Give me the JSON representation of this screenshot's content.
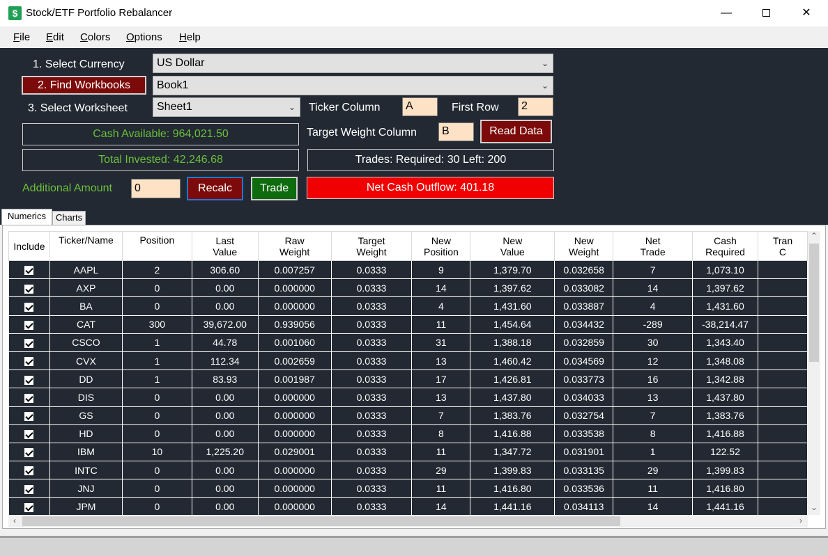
{
  "window": {
    "title": "Stock/ETF Portfolio Rebalancer",
    "minimize": "—",
    "close": "✕"
  },
  "menu": {
    "file": {
      "u": "F",
      "rest": "ile"
    },
    "edit": {
      "u": "E",
      "rest": "dit"
    },
    "colors": {
      "u": "C",
      "rest": "olors"
    },
    "options": {
      "u": "O",
      "rest": "ptions"
    },
    "help": {
      "u": "H",
      "rest": "elp"
    }
  },
  "controls": {
    "select_currency_label": "1. Select Currency",
    "currency_value": "US Dollar",
    "find_workbooks_button": "2. Find Workbooks",
    "workbook_value": "Book1",
    "select_worksheet_label": "3. Select Worksheet",
    "worksheet_value": "Sheet1",
    "ticker_column_label": "Ticker Column",
    "ticker_column_value": "A",
    "first_row_label": "First Row",
    "first_row_value": "2",
    "target_weight_label": "Target Weight Column",
    "target_weight_value": "B",
    "read_data_button": "Read Data",
    "cash_available": "Cash Available: 964,021.50",
    "total_invested": "Total Invested: 42,246.68",
    "trades_info": "Trades: Required: 30 Left: 200",
    "additional_amount_label": "Additional Amount",
    "additional_amount_value": "0",
    "recalc_button": "Recalc",
    "trade_button": "Trade",
    "net_cash": "Net Cash Outflow: 401.18"
  },
  "tabs": {
    "numerics": "Numerics",
    "charts": "Charts"
  },
  "grid": {
    "headers": [
      {
        "l1": "Include",
        "l2": ""
      },
      {
        "l1": "Ticker/Name",
        "l2": ""
      },
      {
        "l1": "Position",
        "l2": ""
      },
      {
        "l1": "Last",
        "l2": "Value"
      },
      {
        "l1": "Raw",
        "l2": "Weight"
      },
      {
        "l1": "Target",
        "l2": "Weight"
      },
      {
        "l1": "New",
        "l2": "Position"
      },
      {
        "l1": "New",
        "l2": "Value"
      },
      {
        "l1": "New",
        "l2": "Weight"
      },
      {
        "l1": "Net",
        "l2": "Trade"
      },
      {
        "l1": "Cash",
        "l2": "Required"
      },
      {
        "l1": "Tran",
        "l2": "C"
      }
    ],
    "rows": [
      [
        "AAPL",
        "2",
        "306.60",
        "0.007257",
        "0.0333",
        "9",
        "1,379.70",
        "0.032658",
        "7",
        "1,073.10"
      ],
      [
        "AXP",
        "0",
        "0.00",
        "0.000000",
        "0.0333",
        "14",
        "1,397.62",
        "0.033082",
        "14",
        "1,397.62"
      ],
      [
        "BA",
        "0",
        "0.00",
        "0.000000",
        "0.0333",
        "4",
        "1,431.60",
        "0.033887",
        "4",
        "1,431.60"
      ],
      [
        "CAT",
        "300",
        "39,672.00",
        "0.939056",
        "0.0333",
        "11",
        "1,454.64",
        "0.034432",
        "-289",
        "-38,214.47"
      ],
      [
        "CSCO",
        "1",
        "44.78",
        "0.001060",
        "0.0333",
        "31",
        "1,388.18",
        "0.032859",
        "30",
        "1,343.40"
      ],
      [
        "CVX",
        "1",
        "112.34",
        "0.002659",
        "0.0333",
        "13",
        "1,460.42",
        "0.034569",
        "12",
        "1,348.08"
      ],
      [
        "DD",
        "1",
        "83.93",
        "0.001987",
        "0.0333",
        "17",
        "1,426.81",
        "0.033773",
        "16",
        "1,342.88"
      ],
      [
        "DIS",
        "0",
        "0.00",
        "0.000000",
        "0.0333",
        "13",
        "1,437.80",
        "0.034033",
        "13",
        "1,437.80"
      ],
      [
        "GS",
        "0",
        "0.00",
        "0.000000",
        "0.0333",
        "7",
        "1,383.76",
        "0.032754",
        "7",
        "1,383.76"
      ],
      [
        "HD",
        "0",
        "0.00",
        "0.000000",
        "0.0333",
        "8",
        "1,416.88",
        "0.033538",
        "8",
        "1,416.88"
      ],
      [
        "IBM",
        "10",
        "1,225.20",
        "0.029001",
        "0.0333",
        "11",
        "1,347.72",
        "0.031901",
        "1",
        "122.52"
      ],
      [
        "INTC",
        "0",
        "0.00",
        "0.000000",
        "0.0333",
        "29",
        "1,399.83",
        "0.033135",
        "29",
        "1,399.83"
      ],
      [
        "JNJ",
        "0",
        "0.00",
        "0.000000",
        "0.0333",
        "11",
        "1,416.80",
        "0.033536",
        "11",
        "1,416.80"
      ],
      [
        "JPM",
        "0",
        "0.00",
        "0.000000",
        "0.0333",
        "14",
        "1,441.16",
        "0.034113",
        "14",
        "1,441.16"
      ]
    ]
  },
  "colors": {
    "panel_bg": "#222932",
    "button_red": "#7d0a0a",
    "button_green": "#0e6b0e",
    "input_bg": "#fde2c6",
    "cash_text": "#6cbf3c",
    "net_cash_bg": "#f00000"
  },
  "icons": {
    "app": "dollar-sign-icon",
    "dropdown": "chevron-down-icon",
    "checkbox": "checkmark-icon"
  }
}
